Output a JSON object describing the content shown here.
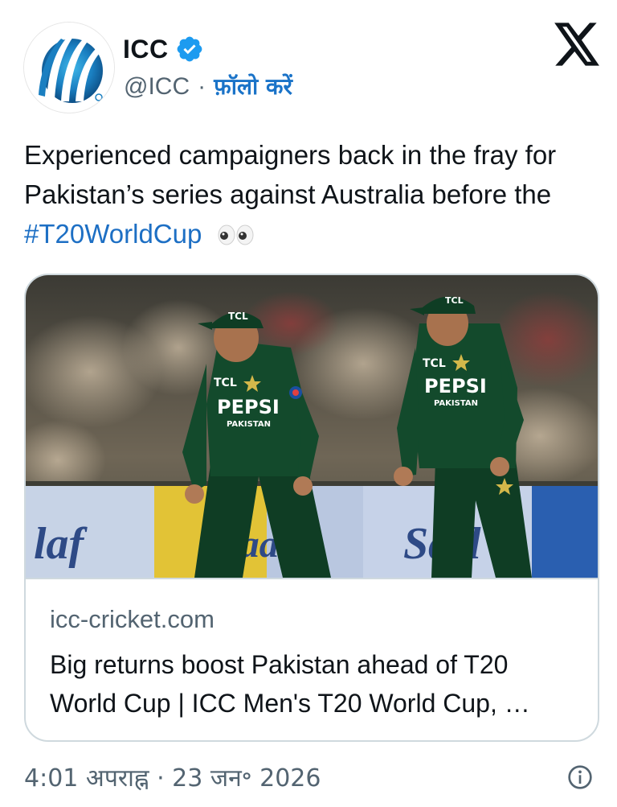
{
  "author": {
    "display_name": "ICC",
    "handle": "@ICC",
    "separator": "·",
    "follow_label": "फ़ॉलो करें",
    "verified_icon": "verified-badge-icon",
    "avatar_icon": "icc-logo"
  },
  "platform_icon": "x-logo-icon",
  "tweet": {
    "text": "Experienced campaigners back in the fray for Pakistan’s series against Australia before the",
    "hashtag": "#T20WorldCup",
    "emoji": "👀"
  },
  "card": {
    "image_description_icon": "photo-pakistan-cricketers",
    "jersey_sponsor": "PEPSI",
    "jersey_country": "PAKISTAN",
    "cap_sponsor": "TCL",
    "domain": "icc-cricket.com",
    "title": "Big returns boost Pakistan ahead of T20 World Cup | ICC Men's T20 World Cup, …"
  },
  "footer": {
    "timestamp": "4:01 अपराह्न · 23 जन॰ 2026",
    "info_icon": "info-icon"
  },
  "colors": {
    "link_blue": "#1d6fc4",
    "verified_blue": "#1d9bf0",
    "secondary_text": "#536471",
    "border": "#cfd9de",
    "jersey_green": "#0f3d24"
  }
}
